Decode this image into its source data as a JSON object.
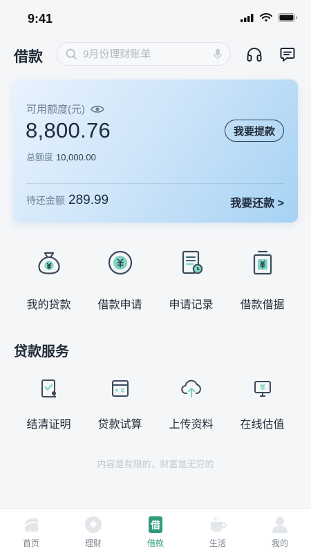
{
  "status_bar": {
    "time": "9:41"
  },
  "header": {
    "title": "借款",
    "search_placeholder": "9月份理财账单",
    "icons": [
      "search-icon",
      "mic-icon",
      "headset-icon",
      "message-icon"
    ]
  },
  "card": {
    "available_label": "可用额度(元)",
    "available_amount": "8,800.76",
    "withdraw_button": "我要提款",
    "total_label": "总额度",
    "total_amount": "10,000.00",
    "due_label": "待还金额",
    "due_amount": "289.99",
    "repay_link": "我要还款 >",
    "colors": {
      "gradient_start": "#e8f3fd",
      "gradient_end": "#a6d2f4"
    }
  },
  "quick_actions": [
    {
      "label": "我的贷款",
      "icon": "money-bag-icon"
    },
    {
      "label": "借款申请",
      "icon": "yuan-coin-icon"
    },
    {
      "label": "申请记录",
      "icon": "document-clock-icon"
    },
    {
      "label": "借款借据",
      "icon": "yuan-receipt-icon"
    }
  ],
  "loan_services": {
    "title": "贷款服务",
    "items": [
      {
        "label": "结清证明",
        "icon": "certificate-check-icon"
      },
      {
        "label": "贷款试算",
        "icon": "calculator-icon"
      },
      {
        "label": "上传资料",
        "icon": "cloud-upload-icon"
      },
      {
        "label": "在线估值",
        "icon": "monitor-yuan-icon"
      }
    ]
  },
  "slogan": "内容是有限的，财富是无穷的",
  "tab_bar": {
    "active": "借款",
    "active_color": "#2f9a7c",
    "tabs": [
      {
        "label": "首页",
        "icon": "home-icon"
      },
      {
        "label": "理财",
        "icon": "wealth-icon"
      },
      {
        "label": "借款",
        "icon": "borrow-icon"
      },
      {
        "label": "生活",
        "icon": "coffee-icon"
      },
      {
        "label": "我的",
        "icon": "user-icon"
      }
    ]
  }
}
